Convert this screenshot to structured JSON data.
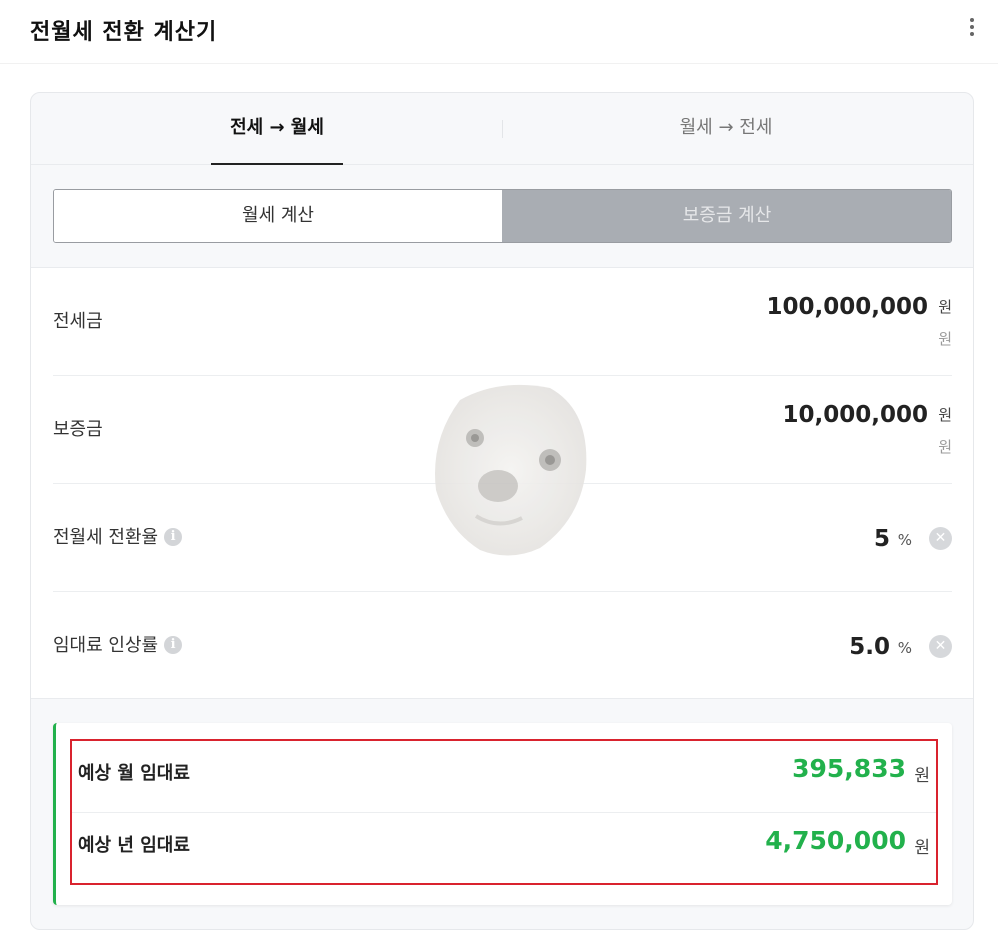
{
  "header": {
    "title": "전월세 전환 계산기"
  },
  "tabs": [
    {
      "label": "전세 → 월세",
      "active": true
    },
    {
      "label": "월세 → 전세",
      "active": false
    }
  ],
  "segment": {
    "options": [
      {
        "label": "월세 계산",
        "selected": true
      },
      {
        "label": "보증금 계산",
        "selected": false
      }
    ]
  },
  "form": {
    "jeonse": {
      "label": "전세금",
      "value": "100,000,000",
      "unit": "원",
      "unit_sub": "원"
    },
    "deposit": {
      "label": "보증금",
      "value": "10,000,000",
      "unit": "원",
      "unit_sub": "원"
    },
    "conversion_rate": {
      "label": "전월세 전환율",
      "value": "5",
      "unit": "%"
    },
    "rent_increase": {
      "label": "임대료 인상률",
      "value": "5.0",
      "unit": "%"
    }
  },
  "result": {
    "monthly": {
      "label": "예상 월 임대료",
      "value": "395,833",
      "unit": "원"
    },
    "yearly": {
      "label": "예상 년 임대료",
      "value": "4,750,000",
      "unit": "원"
    }
  },
  "colors": {
    "accent_green": "#22b14c",
    "highlight_red": "#d9232e",
    "segment_off": "#a9adb3"
  },
  "icons": [
    "kebab-menu-icon",
    "info-icon",
    "clear-icon"
  ]
}
